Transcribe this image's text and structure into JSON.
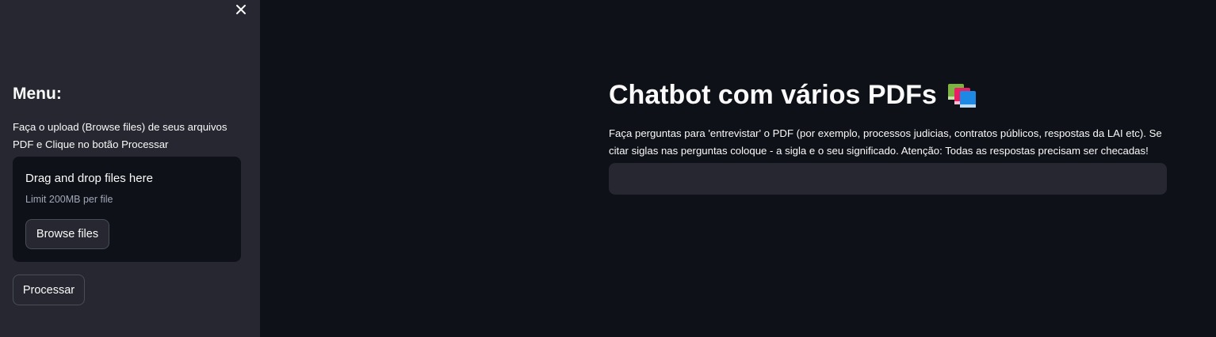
{
  "sidebar": {
    "close_icon": "close-icon",
    "menu_title": "Menu:",
    "instructions": "Faça o upload (Browse files) de seus arquivos PDF e Clique no botão Processar",
    "uploader": {
      "title": "Drag and drop files here",
      "limit": "Limit 200MB per file",
      "browse_label": "Browse files"
    },
    "process_label": "Processar"
  },
  "main": {
    "title": "Chatbot com vários PDFs",
    "title_icon": "books-icon",
    "description": "Faça perguntas para 'entrevistar' o PDF (por exemplo, processos judicias, contratos públicos, respostas da LAI etc). Se citar siglas nas perguntas coloque - a sigla e o seu significado. Atenção: Todas as respostas precisam ser checadas!",
    "question_input": {
      "value": "",
      "placeholder": ""
    }
  },
  "colors": {
    "background": "#0e1117",
    "sidebar": "#262730",
    "text": "#fafafa",
    "muted_text": "#a3a8b8",
    "button_border": "#4a4c57"
  }
}
